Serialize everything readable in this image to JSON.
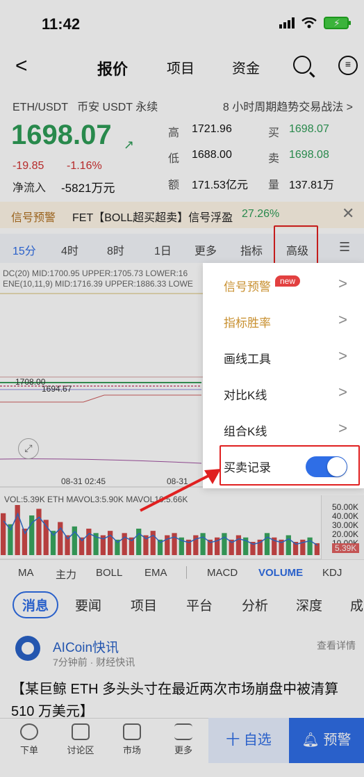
{
  "status": {
    "time": "11:42"
  },
  "nav": {
    "back": "<",
    "tabs": [
      "报价",
      "项目",
      "资金"
    ],
    "msg_icon": "≡"
  },
  "pair": {
    "symbol": "ETH/USDT",
    "market": "币安 USDT 永续",
    "strategy": "8 小时周期趋势交易战法 >"
  },
  "quote": {
    "price": "1698.07",
    "change": "-19.85",
    "change_pct": "-1.16%",
    "net_flow_label": "净流入",
    "net_flow": "-5821万元",
    "high_label": "高",
    "high": "1721.96",
    "low_label": "低",
    "low": "1688.00",
    "amount_label": "额",
    "amount": "171.53亿元",
    "buy_label": "买",
    "buy": "1698.07",
    "sell_label": "卖",
    "sell": "1698.08",
    "volume_label": "量",
    "volume": "137.81万"
  },
  "signal": {
    "tag": "信号预警",
    "text": "FET【BOLL超买超卖】信号浮盈",
    "pct": "27.26%"
  },
  "timeframes": [
    "15分",
    "4时",
    "8时",
    "1日",
    "更多",
    "指标",
    "高级"
  ],
  "chart": {
    "legend1": "DC(20) MID:1700.95 UPPER:1705.73 LOWER:16",
    "legend2": "ENE(10,11,9) MID:1716.39 UPPER:1886.33 LOWE",
    "price_left_1": "1708.00",
    "price_left_2": "1694.67",
    "time_1": "08-31 02:45",
    "time_2": "08-31",
    "vol_legend": "VOL:5.39K ETH MAVOL3:5.90K MAVOL10:5.66K",
    "vol_axis": [
      "50.00K",
      "40.00K",
      "30.00K",
      "20.00K",
      "10.00K"
    ],
    "vol_current": "5.39K"
  },
  "chart_data": {
    "type": "bar",
    "title": "",
    "series": [
      {
        "name": "VOL",
        "values": [
          19,
          14,
          23,
          12,
          18,
          21,
          16,
          11,
          15,
          9,
          13,
          8,
          12,
          10,
          9,
          11,
          7,
          10,
          8,
          12,
          9,
          11,
          7,
          9,
          10,
          8,
          7,
          9,
          10,
          7,
          8,
          10,
          7,
          9,
          8,
          6,
          7,
          10,
          8,
          7,
          9,
          6,
          7,
          8,
          5.39
        ]
      }
    ],
    "y_ticks": [
      "50.00K",
      "40.00K",
      "30.00K",
      "20.00K",
      "10.00K"
    ],
    "ylim": [
      0,
      50
    ]
  },
  "indicators": [
    "MA",
    "主力",
    "BOLL",
    "EMA",
    "MACD",
    "VOLUME",
    "KDJ"
  ],
  "news_tabs": [
    "消息",
    "要闻",
    "项目",
    "平台",
    "分析",
    "深度",
    "成"
  ],
  "news": {
    "source": "AICoin快讯",
    "meta": "7分钟前 · 财经快讯",
    "more": "查看详情",
    "title": "【某巨鲸 ETH 多头头寸在最近两次市场崩盘中被清算 510 万美元】"
  },
  "bottom": {
    "items": [
      "下单",
      "讨论区",
      "市场",
      "更多"
    ],
    "fav": "十 自选",
    "alert": "预警"
  },
  "popup": {
    "items": [
      "信号预警",
      "指标胜率",
      "画线工具",
      "对比K线",
      "组合K线",
      "买卖记录"
    ],
    "new_badge": "new",
    "chevron": ">"
  }
}
